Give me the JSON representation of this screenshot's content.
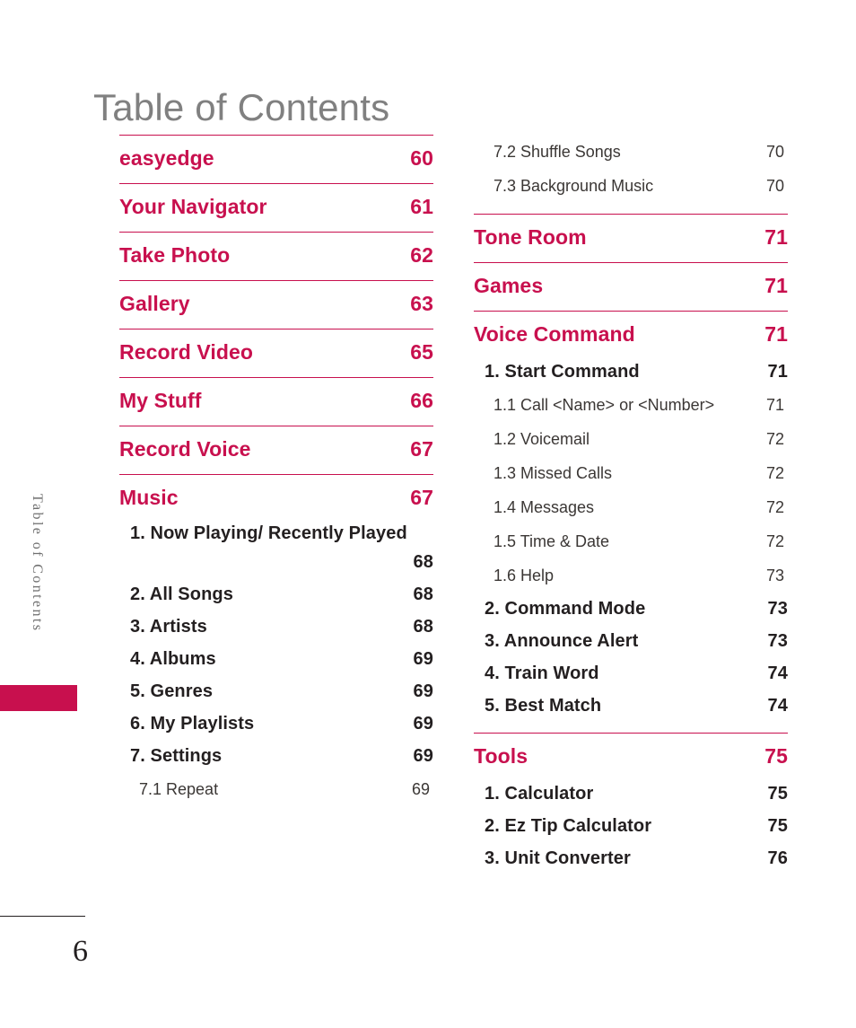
{
  "page": {
    "title": "Table of Contents",
    "side_tab_label": "Table of Contents",
    "page_number": "6",
    "accent_color": "#C8104E",
    "title_color": "#808080",
    "body_color": "#231F20"
  },
  "columns": {
    "left": [
      {
        "level": 1,
        "label": "easyedge",
        "page": "60"
      },
      {
        "level": 1,
        "label": "Your Navigator",
        "page": "61"
      },
      {
        "level": 1,
        "label": "Take Photo",
        "page": "62"
      },
      {
        "level": 1,
        "label": "Gallery",
        "page": "63"
      },
      {
        "level": 1,
        "label": "Record Video",
        "page": "65"
      },
      {
        "level": 1,
        "label": "My Stuff",
        "page": "66"
      },
      {
        "level": 1,
        "label": "Record Voice",
        "page": "67"
      },
      {
        "level": 1,
        "label": "Music",
        "page": "67"
      },
      {
        "level": 2,
        "label": "1. Now Playing/ Recently Played",
        "page": "68",
        "wrap": true
      },
      {
        "level": 2,
        "label": "2. All Songs",
        "page": "68"
      },
      {
        "level": 2,
        "label": "3. Artists",
        "page": "68"
      },
      {
        "level": 2,
        "label": "4. Albums",
        "page": "69"
      },
      {
        "level": 2,
        "label": "5. Genres",
        "page": "69"
      },
      {
        "level": 2,
        "label": "6. My Playlists",
        "page": "69"
      },
      {
        "level": 2,
        "label": "7. Settings",
        "page": "69"
      },
      {
        "level": 3,
        "label": "7.1 Repeat",
        "page": "69"
      }
    ],
    "right": [
      {
        "level": 3,
        "label": "7.2 Shuffle Songs",
        "page": "70"
      },
      {
        "level": 3,
        "label": "7.3 Background Music",
        "page": "70"
      },
      {
        "level": 1,
        "label": "Tone Room",
        "page": "71"
      },
      {
        "level": 1,
        "label": "Games",
        "page": "71"
      },
      {
        "level": 1,
        "label": "Voice Command",
        "page": "71"
      },
      {
        "level": 2,
        "label": "1. Start Command",
        "page": "71"
      },
      {
        "level": 3,
        "label": "1.1 Call <Name> or <Number>",
        "page": "71"
      },
      {
        "level": 3,
        "label": "1.2 Voicemail",
        "page": "72"
      },
      {
        "level": 3,
        "label": "1.3 Missed Calls",
        "page": "72"
      },
      {
        "level": 3,
        "label": "1.4 Messages",
        "page": "72"
      },
      {
        "level": 3,
        "label": "1.5 Time & Date",
        "page": "72"
      },
      {
        "level": 3,
        "label": "1.6 Help",
        "page": "73"
      },
      {
        "level": 2,
        "label": "2. Command Mode",
        "page": "73"
      },
      {
        "level": 2,
        "label": "3. Announce Alert",
        "page": "73"
      },
      {
        "level": 2,
        "label": "4. Train Word",
        "page": "74"
      },
      {
        "level": 2,
        "label": "5. Best Match",
        "page": "74"
      },
      {
        "level": 1,
        "label": "Tools",
        "page": "75"
      },
      {
        "level": 2,
        "label": "1. Calculator",
        "page": "75"
      },
      {
        "level": 2,
        "label": "2. Ez Tip Calculator",
        "page": "75"
      },
      {
        "level": 2,
        "label": "3. Unit Converter",
        "page": "76"
      }
    ]
  }
}
